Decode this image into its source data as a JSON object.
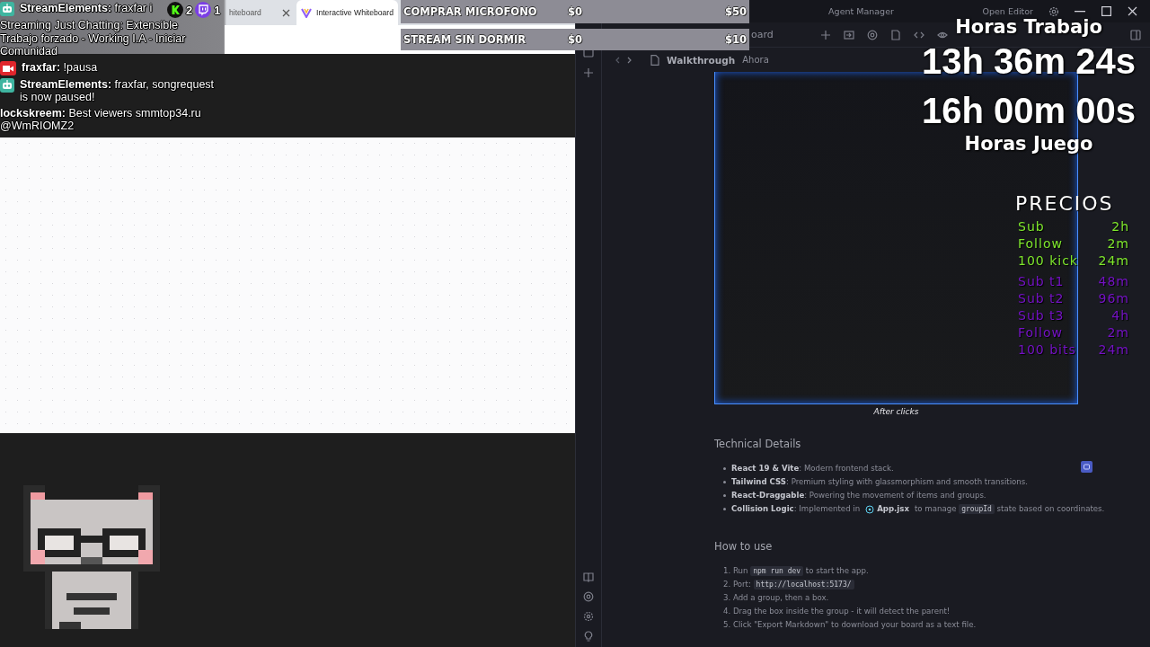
{
  "browser": {
    "tabs": [
      {
        "label": "hiteboard",
        "selected": false
      },
      {
        "label": "Interactive Whiteboard",
        "selected": true
      }
    ]
  },
  "chat": {
    "messages": [
      {
        "kind": "bot",
        "user": "StreamElements:",
        "text": "fraxfar i",
        "text_2": "Streaming Just Chatting: Extensible Trabajo forzado - Working I.A - Iniciar Comunidad"
      },
      {
        "kind": "camera",
        "user": "fraxfar:",
        "text": "!pausa"
      },
      {
        "kind": "bot",
        "user": "StreamElements:",
        "text": "fraxfar, songrequest is now paused!"
      },
      {
        "kind": "plain",
        "user": "lockskreem:",
        "text": "Best viewers smmtop34.ru @WmRIOMZ2"
      }
    ]
  },
  "viewer_counts": [
    {
      "kind": "kick",
      "count": "2"
    },
    {
      "kind": "twitch",
      "count": "1"
    }
  ],
  "goals": [
    {
      "label": "COMPRAR MICROFONO",
      "current": "$0",
      "target": "$50"
    },
    {
      "label": "STREAM SIN DORMIR",
      "current": "$0",
      "target": "$10"
    }
  ],
  "app": {
    "title": "Agent Manager",
    "open_editor": "Open Editor",
    "toolbar_title": "oard",
    "breadcrumb": {
      "title": "Walkthrough",
      "time": "Ahora"
    },
    "figure_caption": "After clicks",
    "sections": [
      {
        "heading": "Technical Details",
        "kind": "bullets",
        "items": [
          [
            {
              "kind": "bold",
              "text": "React 19 & Vite"
            },
            {
              "kind": "text",
              "text": ": Modern frontend stack."
            }
          ],
          [
            {
              "kind": "bold",
              "text": "Tailwind CSS"
            },
            {
              "kind": "text",
              "text": ": Premium styling with glassmorphism and smooth transitions."
            }
          ],
          [
            {
              "kind": "bold",
              "text": "React-Draggable"
            },
            {
              "kind": "text",
              "text": ": Powering the movement of items and groups."
            }
          ],
          [
            {
              "kind": "bold",
              "text": "Collision Logic"
            },
            {
              "kind": "text",
              "text": ": Implemented in"
            },
            {
              "kind": "file",
              "text": "App.jsx"
            },
            {
              "kind": "text",
              "text": "to manage "
            },
            {
              "kind": "code",
              "text": "groupId"
            },
            {
              "kind": "text",
              "text": " state based on coordinates."
            }
          ]
        ]
      },
      {
        "heading": "How to use",
        "kind": "numbered",
        "items": [
          [
            {
              "kind": "text",
              "text": "1. Run "
            },
            {
              "kind": "code",
              "text": "npm run dev"
            },
            {
              "kind": "text",
              "text": " to start the app."
            }
          ],
          [
            {
              "kind": "text",
              "text": "2. Port: "
            },
            {
              "kind": "code",
              "text": "http://localhost:5173/"
            }
          ],
          [
            {
              "kind": "text",
              "text": "3. Add a group, then a box."
            }
          ],
          [
            {
              "kind": "text",
              "text": "4. Drag the box inside the group - it will detect the parent!"
            }
          ],
          [
            {
              "kind": "text",
              "text": "5. Click \"Export Markdown\" to download your board as a text file."
            }
          ]
        ]
      }
    ]
  },
  "timer": {
    "work_label": "Horas Trabajo",
    "work_time": "13h 36m 24s",
    "game_time": "16h 00m 00s",
    "game_label": "Horas Juego"
  },
  "prices": {
    "title": "PRECIOS",
    "groups": [
      {
        "items": [
          {
            "label": "Sub",
            "value": "2h",
            "color": "#7ee62c"
          },
          {
            "label": "Follow",
            "value": "2m",
            "color": "#7ee62c"
          },
          {
            "label": "100 kick",
            "value": "24m",
            "color": "#7ee62c"
          }
        ]
      },
      {
        "items": [
          {
            "label": "Sub t1",
            "value": "48m",
            "color": "#7412c4"
          },
          {
            "label": "Sub t2",
            "value": "96m",
            "color": "#7412c4"
          },
          {
            "label": "Sub t3",
            "value": "4h",
            "color": "#7412c4"
          },
          {
            "label": "Follow",
            "value": "2m",
            "color": "#7412c4"
          },
          {
            "label": "100 bits",
            "value": "24m",
            "color": "#7412c4"
          }
        ]
      }
    ]
  }
}
